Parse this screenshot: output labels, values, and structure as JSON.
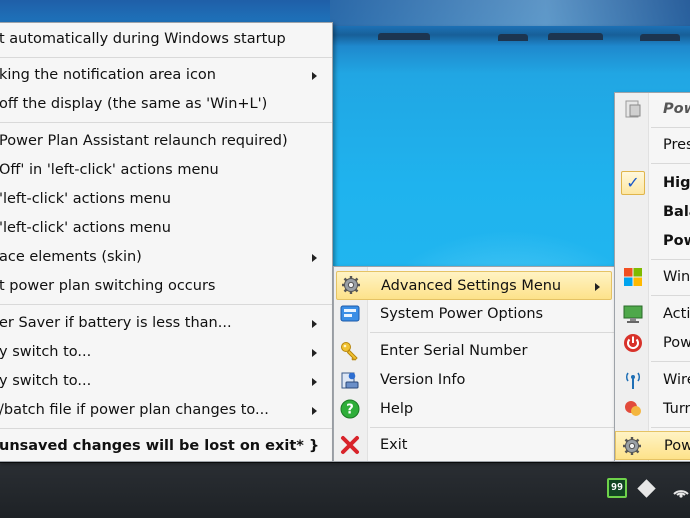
{
  "left_menu": {
    "items": [
      {
        "label": "t automatically during Windows startup",
        "submenu": false
      },
      {
        "label": "king the notification area icon",
        "submenu": true
      },
      {
        "label": "off the display (the same as 'Win+L')",
        "submenu": false
      },
      {
        "label": "Power Plan Assistant relaunch required)",
        "submenu": false
      },
      {
        "label": "Off' in 'left-click' actions menu",
        "submenu": false
      },
      {
        "label": "'left-click' actions menu",
        "submenu": false
      },
      {
        "label": "'left-click' actions menu",
        "submenu": false
      },
      {
        "label": "ace elements (skin)",
        "submenu": true
      },
      {
        "label": "t power plan switching occurs",
        "submenu": false
      },
      {
        "label": "er Saver if battery is less than...",
        "submenu": true
      },
      {
        "label": "y switch to...",
        "submenu": true
      },
      {
        "label": "y switch to...",
        "submenu": true
      },
      {
        "label": "/batch file if power plan changes to...",
        "submenu": true
      },
      {
        "label": "unsaved changes will be lost on exit* }",
        "submenu": false
      }
    ]
  },
  "middle_menu": {
    "items": [
      {
        "label": "Advanced Settings Menu",
        "icon": "gear-icon",
        "submenu": true,
        "highlighted": true
      },
      {
        "label": "System Power Options",
        "icon": "power-options-icon",
        "submenu": false
      },
      {
        "label": "Enter Serial Number",
        "icon": "key-icon",
        "submenu": false
      },
      {
        "label": "Version Info",
        "icon": "version-info-icon",
        "submenu": false
      },
      {
        "label": "Help",
        "icon": "help-icon",
        "submenu": false
      },
      {
        "label": "Exit",
        "icon": "exit-icon",
        "submenu": false
      }
    ]
  },
  "right_menu": {
    "items": [
      {
        "label": "Pow",
        "icon": "app-icon",
        "style": "italic-bold"
      },
      {
        "label": "Pres",
        "icon": "",
        "style": "normal"
      },
      {
        "label": "Hig",
        "icon": "checkmark-icon",
        "style": "bold"
      },
      {
        "label": "Bala",
        "icon": "",
        "style": "bold"
      },
      {
        "label": "Pow",
        "icon": "",
        "style": "bold"
      },
      {
        "label": "Win",
        "icon": "windows-logo-icon",
        "style": "normal"
      },
      {
        "label": "Acti",
        "icon": "monitor-icon",
        "style": "normal"
      },
      {
        "label": "Pow",
        "icon": "power-icon",
        "style": "normal"
      },
      {
        "label": "Wire",
        "icon": "wireless-icon",
        "style": "normal"
      },
      {
        "label": "Turn",
        "icon": "turn-off-icon",
        "style": "normal"
      },
      {
        "label": "Pow",
        "icon": "gear-icon",
        "style": "normal",
        "highlighted": true
      }
    ]
  },
  "taskbar": {
    "battery_percent": "99",
    "tray_icons": [
      "battery-icon",
      "diamond-icon",
      "wifi-icon"
    ]
  },
  "colors": {
    "menu_bg": "#f6f6f6",
    "highlight": "#fde28a",
    "taskbar": "#24282c",
    "sea": "#1fb3ee"
  }
}
